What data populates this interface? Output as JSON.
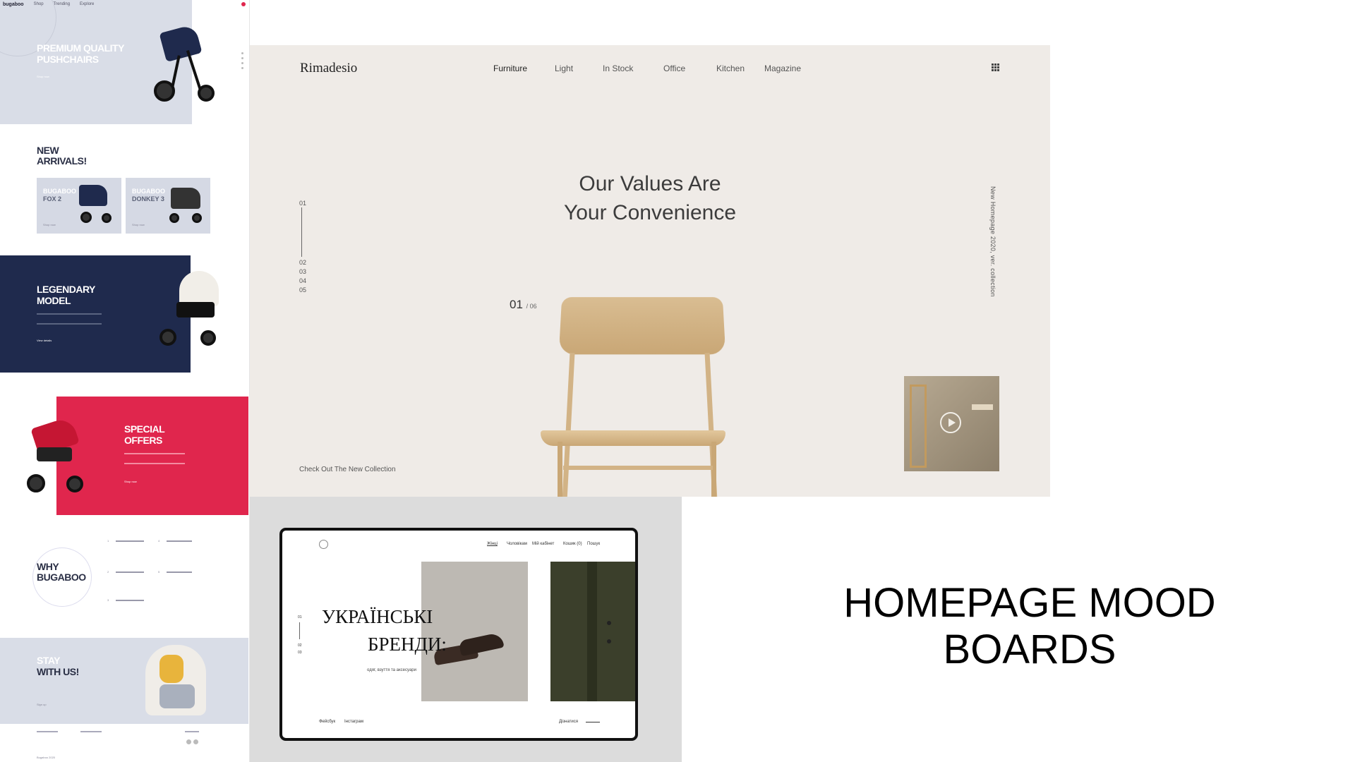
{
  "bugaboo": {
    "logo": "bugaboo",
    "nav": [
      "Shop",
      "Trending",
      "Explore"
    ],
    "hero": {
      "title_line1": "PREMIUM QUALITY",
      "title_line2": "PUSHCHAIRS",
      "cta": "Shop now"
    },
    "new_arrivals": {
      "title_line1": "NEW",
      "title_line2": "ARRIVALS!",
      "cards": [
        {
          "brand": "BUGABOO",
          "model": "FOX 2",
          "cta": "Shop now"
        },
        {
          "brand": "BUGABOO",
          "model": "DONKEY 3",
          "cta": "Shop now"
        }
      ]
    },
    "legendary": {
      "title_line1": "LEGENDARY",
      "title_line2": "MODEL",
      "cta": "View details"
    },
    "special": {
      "title_line1": "SPECIAL",
      "title_line2": "OFFERS",
      "cta": "Shop now"
    },
    "why": {
      "title_line1": "WHY",
      "title_line2": "BUGABOO",
      "features": [
        "1",
        "2",
        "3",
        "4",
        "5"
      ]
    },
    "stay": {
      "title_line1": "STAY",
      "title_line2": "WITH US!",
      "cta": "Sign up"
    },
    "footer": {
      "copyright": "Bugaboo 2020"
    }
  },
  "rimadesio": {
    "logo": "Rimadesio",
    "nav": [
      "Furniture",
      "Light",
      "In Stock",
      "Office",
      "Kitchen",
      "Magazine"
    ],
    "title_line1": "Our Values Are",
    "title_line2": "Your Convenience",
    "slide_index": [
      "01",
      "02",
      "03",
      "04",
      "05"
    ],
    "counter_current": "01",
    "counter_total": "/ 06",
    "vertical_text": "New Homepage 2020, ver. collection",
    "cta": "Check Out The New Collection"
  },
  "ukrainian": {
    "nav": [
      "Жінці",
      "Чоловікам",
      "Мій кабінет",
      "Кошик (0)",
      "Пошук"
    ],
    "title_line1": "УКРАЇНСЬКІ",
    "title_line2": "БРЕНДИ:",
    "subtitle": "одяг, взуття та аксесуари",
    "index": [
      "01",
      "02",
      "03"
    ],
    "footer_left": [
      "Фейсбук",
      "Інстаграм"
    ],
    "footer_right": "Дізнатися"
  },
  "caption_line1": "HOMEPAGE MOOD",
  "caption_line2": "BOARDS",
  "colors": {
    "navy": "#1f2a4d",
    "red": "#e0264d",
    "beige": "#efebe7",
    "lavender": "#d9dde7"
  }
}
